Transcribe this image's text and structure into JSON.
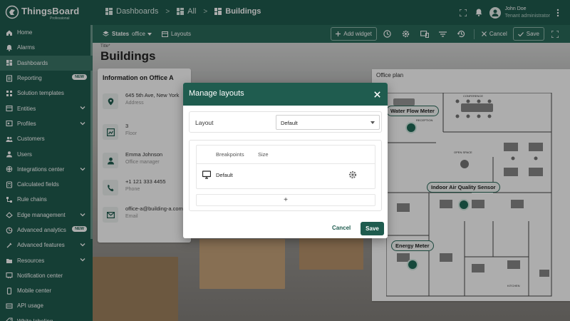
{
  "app": {
    "logo_title": "ThingsBoard",
    "logo_subtitle": "Professional"
  },
  "breadcrumbs": [
    {
      "label": "Dashboards",
      "icon": "dashboard-icon"
    },
    {
      "label": "All",
      "icon": "dashboard-icon"
    },
    {
      "label": "Buildings",
      "icon": "dashboard-icon"
    }
  ],
  "user": {
    "name": "John Doe",
    "role": "Tenant administrator"
  },
  "sidebar": {
    "items": [
      {
        "label": "Home",
        "icon": "home-icon"
      },
      {
        "label": "Alarms",
        "icon": "alarm-icon"
      },
      {
        "label": "Dashboards",
        "icon": "dashboard-icon",
        "active": true
      },
      {
        "label": "Reporting",
        "icon": "report-icon",
        "badge": "NEW"
      },
      {
        "label": "Solution templates",
        "icon": "apps-icon"
      },
      {
        "label": "Entities",
        "icon": "entities-icon",
        "expandable": true
      },
      {
        "label": "Profiles",
        "icon": "profiles-icon",
        "expandable": true
      },
      {
        "label": "Customers",
        "icon": "customers-icon"
      },
      {
        "label": "Users",
        "icon": "users-icon"
      },
      {
        "label": "Integrations center",
        "icon": "integrations-icon",
        "expandable": true
      },
      {
        "label": "Calculated fields",
        "icon": "calculated-icon"
      },
      {
        "label": "Rule chains",
        "icon": "rule-chains-icon"
      },
      {
        "label": "Edge management",
        "icon": "edge-icon",
        "expandable": true
      },
      {
        "label": "Advanced analytics",
        "icon": "analytics-icon",
        "badge": "NEW"
      },
      {
        "label": "Advanced features",
        "icon": "features-icon",
        "expandable": true
      },
      {
        "label": "Resources",
        "icon": "resources-icon",
        "expandable": true
      },
      {
        "label": "Notification center",
        "icon": "notification-icon"
      },
      {
        "label": "Mobile center",
        "icon": "mobile-icon"
      },
      {
        "label": "API usage",
        "icon": "api-icon"
      },
      {
        "label": "White labeling",
        "icon": "white-label-icon"
      }
    ]
  },
  "toolbar": {
    "states_label": "States",
    "state_value": "office",
    "layouts_label": "Layouts",
    "add_widget_label": "Add widget",
    "cancel_label": "Cancel",
    "save_label": "Save"
  },
  "dashboard": {
    "title_hint": "Title*",
    "title": "Buildings",
    "info_card": {
      "title": "Information on Office A",
      "rows": [
        {
          "value": "645 5th Ave, New York",
          "label": "Address",
          "icon": "map-pin-icon"
        },
        {
          "value": "3",
          "label": "Floor",
          "icon": "floor-icon"
        },
        {
          "value": "Emma Johnson",
          "label": "Office manager",
          "icon": "person-icon"
        },
        {
          "value": "+1 121 333 4455",
          "label": "Phone",
          "icon": "phone-icon"
        },
        {
          "value": "office-a@building-a.com",
          "label": "Email",
          "icon": "email-icon"
        }
      ]
    },
    "plan": {
      "title": "Office plan",
      "labels": [
        "Water Flow Meter",
        "Indoor Air Quality Sensor",
        "Energy Meter"
      ],
      "room_labels": [
        "CONFERENCE",
        "RECEPTION",
        "OPEN SPACE",
        "KITCHEN"
      ]
    }
  },
  "dialog": {
    "title": "Manage layouts",
    "layout_label": "Layout",
    "layout_value": "Default",
    "col_breakpoints": "Breakpoints",
    "col_size": "Size",
    "row_name": "Default",
    "add_symbol": "+",
    "cancel_label": "Cancel",
    "save_label": "Save"
  },
  "colors": {
    "primary": "#1f5c4f",
    "toolbar": "#2a6a5b",
    "sidebar_active": "#3b7668"
  }
}
